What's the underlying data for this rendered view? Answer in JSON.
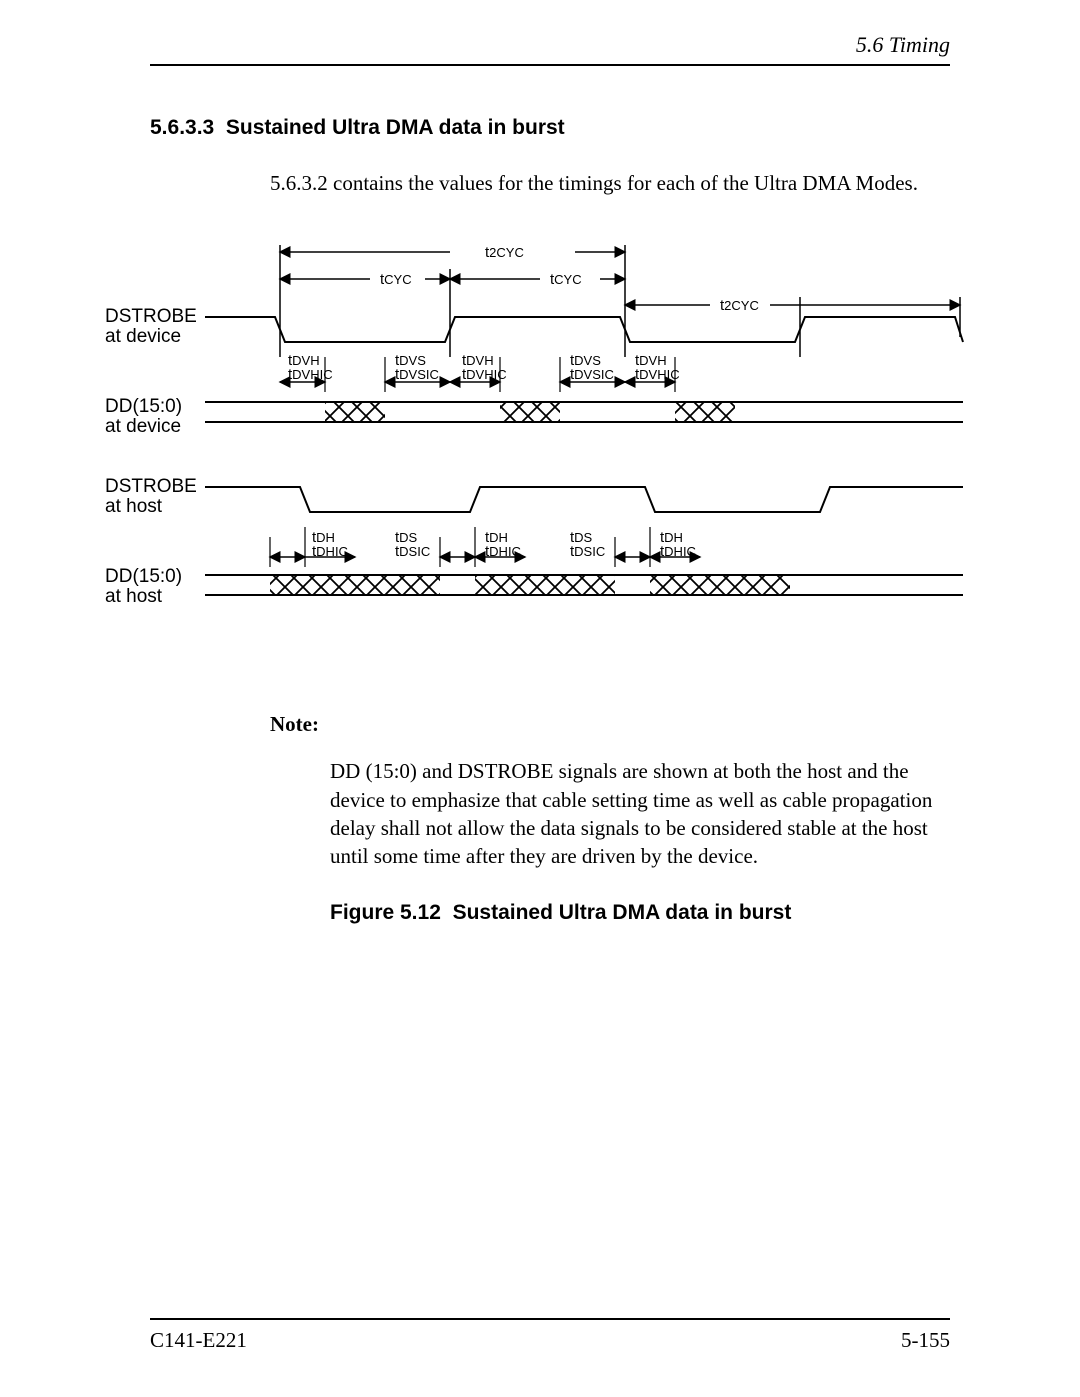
{
  "header": {
    "section": "5.6  Timing"
  },
  "section": {
    "number": "5.6.3.3",
    "title": "Sustained Ultra DMA data in burst"
  },
  "intro": "5.6.3.2 contains the values for the timings for each of the Ultra DMA Modes.",
  "note": {
    "label": "Note:",
    "body": "DD (15:0) and DSTROBE signals are shown at both the host and the device to emphasize that cable setting time as well as cable propagation delay shall not allow the data signals to be considered stable at the host until some time after they are driven by the device."
  },
  "figure": {
    "label": "Figure 5.12",
    "title": "Sustained Ultra DMA data in burst"
  },
  "footer": {
    "left": "C141-E221",
    "right": "5-155"
  },
  "diagram": {
    "signals": {
      "dstrobe_device": "DSTROBE\nat device",
      "dd_device": "DD(15:0)\nat device",
      "dstrobe_host": "DSTROBE\nat host",
      "dd_host": "DD(15:0)\nat host"
    },
    "top_labels": {
      "t2cyc": "t",
      "t2cyc_sub": "2CYC",
      "tcyc": "t",
      "tcyc_sub": "CYC"
    },
    "device_params": {
      "tdvh": "t",
      "tdvh_sub": "DVH",
      "tdvhic": "t",
      "tdvhic_sub": "DVHIC",
      "tdvs": "t",
      "tdvs_sub": "DVS",
      "tdvsic": "t",
      "tdvsic_sub": "DVSIC"
    },
    "host_params": {
      "tdh": "t",
      "tdh_sub": "DH",
      "tdhic": "t",
      "tdhic_sub": "DHIC",
      "tds": "t",
      "tds_sub": "DS",
      "tdsic": "t",
      "tdsic_sub": "DSIC"
    }
  }
}
